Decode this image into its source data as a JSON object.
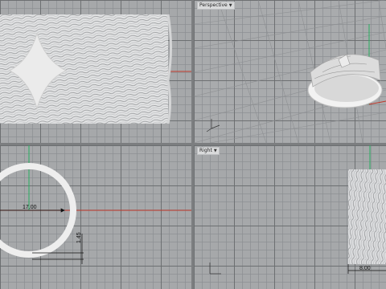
{
  "viewports": {
    "top": {
      "label": ""
    },
    "perspective": {
      "label": "Perspective",
      "menu_icon": "chevron-down-icon"
    },
    "front": {
      "label": ""
    },
    "right": {
      "label": "Right",
      "menu_icon": "chevron-down-icon"
    }
  },
  "dimensions": {
    "diameter": "17.00",
    "thickness": "1.45",
    "width": "8.00"
  },
  "colors": {
    "viewport_bg": "#a6a8aa",
    "grid_major": "#696b6e",
    "axis_x": "#c0392b",
    "axis_y": "#27ae60",
    "ring": "#eeeeee"
  }
}
